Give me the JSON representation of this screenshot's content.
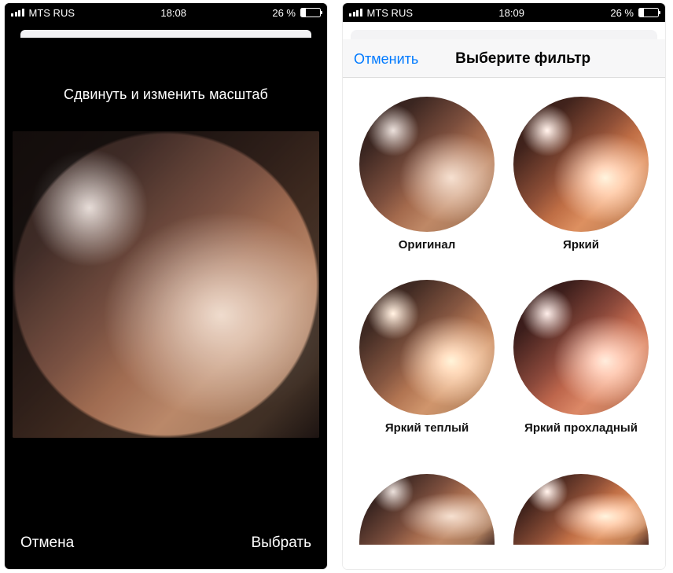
{
  "status_left": {
    "carrier": "MTS RUS",
    "time": "18:08",
    "battery_text": "26 %"
  },
  "status_right": {
    "carrier": "MTS RUS",
    "time": "18:09",
    "battery_text": "26 %"
  },
  "crop": {
    "title": "Сдвинуть и изменить масштаб",
    "cancel": "Отмена",
    "choose": "Выбрать"
  },
  "filters_screen": {
    "cancel": "Отменить",
    "title": "Выберите фильтр",
    "items": [
      {
        "label": "Оригинал"
      },
      {
        "label": "Яркий"
      },
      {
        "label": "Яркий теплый"
      },
      {
        "label": "Яркий прохладный"
      },
      {
        "label": ""
      },
      {
        "label": ""
      }
    ]
  }
}
